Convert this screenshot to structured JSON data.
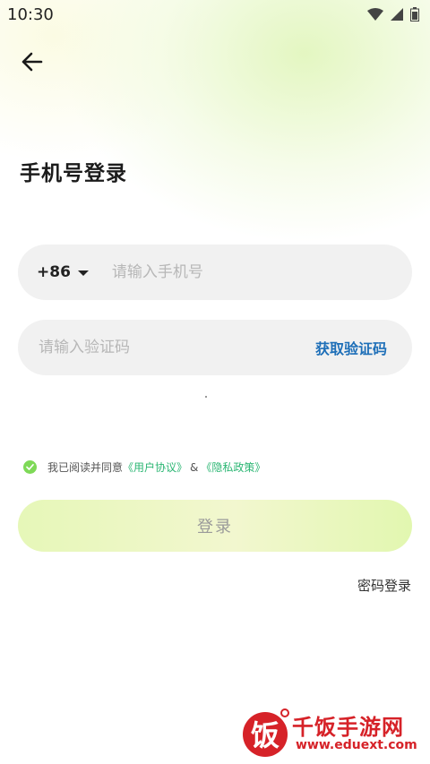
{
  "status_bar": {
    "time": "10:30"
  },
  "header": {
    "back_icon": "arrow-left-icon"
  },
  "page": {
    "title": "手机号登录"
  },
  "phone_field": {
    "country_code": "+86",
    "placeholder": "请输入手机号"
  },
  "code_field": {
    "placeholder": "请输入验证码",
    "get_code_label": "获取验证码"
  },
  "agreement": {
    "checked": true,
    "prefix": "我已阅读并同意",
    "user_agreement": "《用户协议》",
    "amp": "&",
    "privacy_policy": "《隐私政策》"
  },
  "login": {
    "button_label": "登录",
    "password_login_label": "密码登录"
  },
  "watermark": {
    "logo_char": "饭",
    "title": "千饭手游网",
    "url": "www.eduext.com"
  },
  "colors": {
    "accent_link": "#1e6fb8",
    "agree_link": "#2bb673",
    "watermark_red": "#d62228"
  }
}
